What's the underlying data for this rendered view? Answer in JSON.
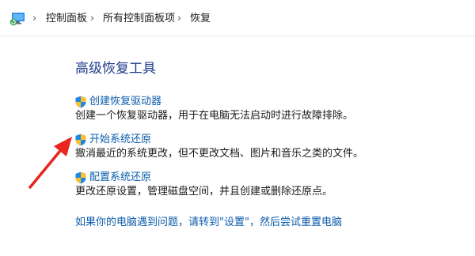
{
  "breadcrumb": {
    "icon": "control-panel-icon",
    "items": [
      "控制面板",
      "所有控制面板项",
      "恢复"
    ],
    "separator": "›"
  },
  "main": {
    "heading": "高级恢复工具",
    "tasks": [
      {
        "icon": "uac-shield-icon",
        "link": "创建恢复驱动器",
        "description": "创建一个恢复驱动器，用于在电脑无法启动时进行故障排除。"
      },
      {
        "icon": "uac-shield-icon",
        "link": "开始系统还原",
        "description": "撤消最近的系统更改，但不更改文档、图片和音乐之类的文件。"
      },
      {
        "icon": "uac-shield-icon",
        "link": "配置系统还原",
        "description": "更改还原设置，管理磁盘空间，并且创建或删除还原点。"
      }
    ],
    "bottom_link": "如果你的电脑遇到问题，请转到\"设置\"，然后尝试重置电脑"
  },
  "colors": {
    "link": "#0b5cab",
    "heading": "#1f3b8c",
    "annotation_arrow": "#e8251f"
  }
}
